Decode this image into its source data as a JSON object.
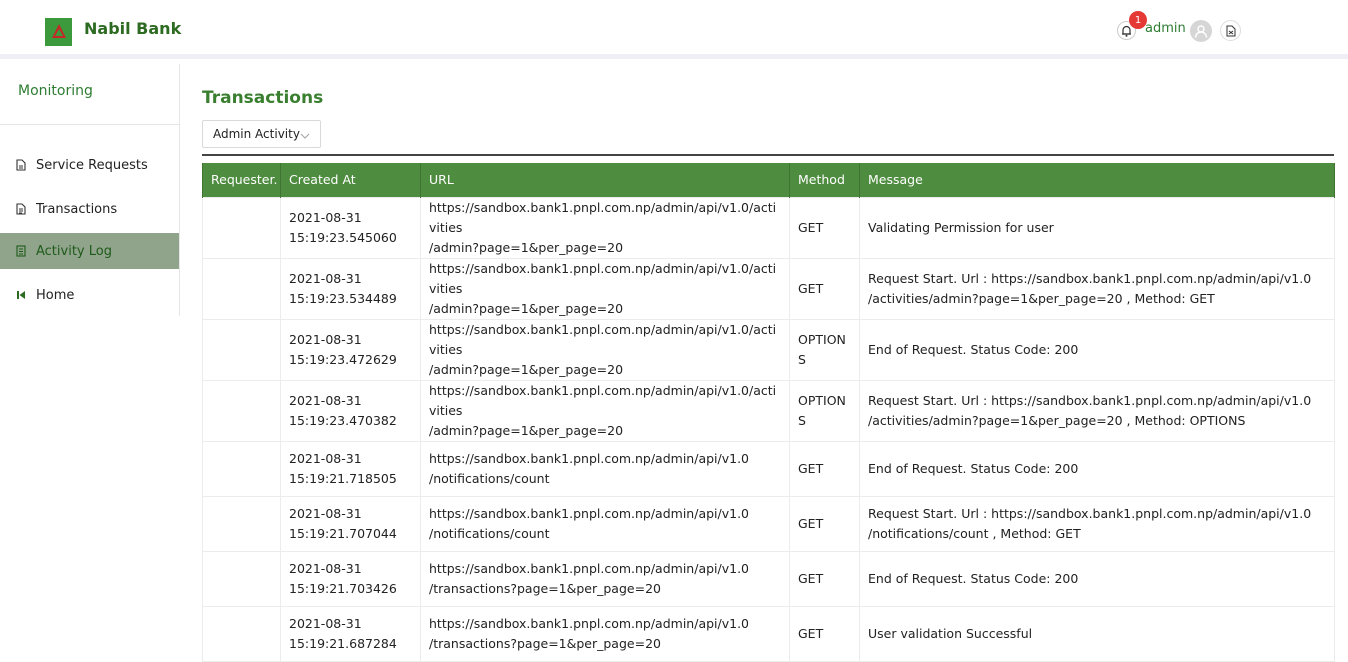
{
  "header": {
    "brand": "Nabil Bank",
    "notification_count": "1",
    "user_name": "admin"
  },
  "sidebar": {
    "title": "Monitoring",
    "items": [
      {
        "label": "Service Requests",
        "icon": "file-icon"
      },
      {
        "label": "Transactions",
        "icon": "file-list-icon"
      },
      {
        "label": "Activity Log",
        "icon": "log-icon",
        "active": true
      },
      {
        "label": "Home",
        "icon": "back-to-start-icon"
      }
    ]
  },
  "main": {
    "title": "Transactions",
    "filter_selected": "Admin Activity",
    "columns": [
      "Requester.",
      "Created At",
      "URL",
      "Method",
      "Message"
    ],
    "rows": [
      {
        "requester": "",
        "created_date": "2021-08-31",
        "created_time": "15:19:23.545060",
        "url1": "https://sandbox.bank1.pnpl.com.np/admin/api/v1.0/activities",
        "url2": "/admin?page=1&per_page=20",
        "method": "GET",
        "msg1": "Validating Permission for user",
        "msg2": ""
      },
      {
        "requester": "",
        "created_date": "2021-08-31",
        "created_time": "15:19:23.534489",
        "url1": "https://sandbox.bank1.pnpl.com.np/admin/api/v1.0/activities",
        "url2": "/admin?page=1&per_page=20",
        "method": "GET",
        "msg1": "Request Start. Url : https://sandbox.bank1.pnpl.com.np/admin/api/v1.0",
        "msg2": "/activities/admin?page=1&per_page=20 , Method: GET"
      },
      {
        "requester": "",
        "created_date": "2021-08-31",
        "created_time": "15:19:23.472629",
        "url1": "https://sandbox.bank1.pnpl.com.np/admin/api/v1.0/activities",
        "url2": "/admin?page=1&per_page=20",
        "method": "OPTIONS",
        "msg1": "End of Request. Status Code: 200",
        "msg2": ""
      },
      {
        "requester": "",
        "created_date": "2021-08-31",
        "created_time": "15:19:23.470382",
        "url1": "https://sandbox.bank1.pnpl.com.np/admin/api/v1.0/activities",
        "url2": "/admin?page=1&per_page=20",
        "method": "OPTIONS",
        "msg1": "Request Start. Url : https://sandbox.bank1.pnpl.com.np/admin/api/v1.0",
        "msg2": "/activities/admin?page=1&per_page=20 , Method: OPTIONS"
      },
      {
        "requester": "",
        "created_date": "2021-08-31",
        "created_time": "15:19:21.718505",
        "url1": "https://sandbox.bank1.pnpl.com.np/admin/api/v1.0",
        "url2": "/notifications/count",
        "method": "GET",
        "msg1": "End of Request. Status Code: 200",
        "msg2": ""
      },
      {
        "requester": "",
        "created_date": "2021-08-31",
        "created_time": "15:19:21.707044",
        "url1": "https://sandbox.bank1.pnpl.com.np/admin/api/v1.0",
        "url2": "/notifications/count",
        "method": "GET",
        "msg1": "Request Start. Url : https://sandbox.bank1.pnpl.com.np/admin/api/v1.0",
        "msg2": "/notifications/count , Method: GET"
      },
      {
        "requester": "",
        "created_date": "2021-08-31",
        "created_time": "15:19:21.703426",
        "url1": "https://sandbox.bank1.pnpl.com.np/admin/api/v1.0",
        "url2": "/transactions?page=1&per_page=20",
        "method": "GET",
        "msg1": "End of Request. Status Code: 200",
        "msg2": ""
      },
      {
        "requester": "",
        "created_date": "2021-08-31",
        "created_time": "15:19:21.687284",
        "url1": "https://sandbox.bank1.pnpl.com.np/admin/api/v1.0",
        "url2": "/transactions?page=1&per_page=20",
        "method": "GET",
        "msg1": "User validation Successful",
        "msg2": ""
      }
    ]
  }
}
